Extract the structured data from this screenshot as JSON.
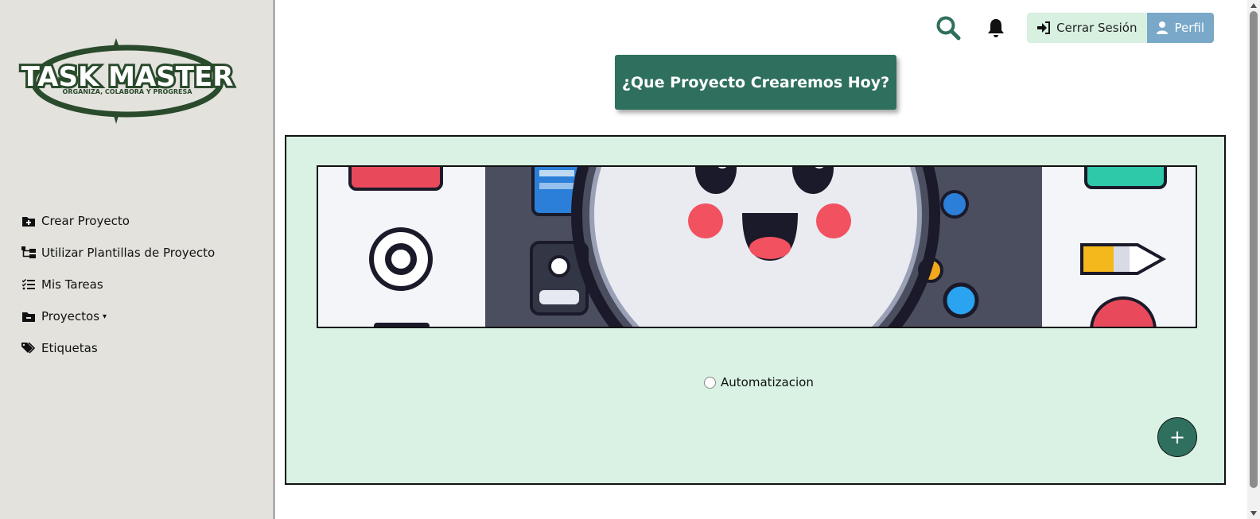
{
  "logo": {
    "title": "TASK MASTER",
    "tagline": "ORGANIZA, COLABORA Y PROGRESA"
  },
  "sidebar": {
    "items": [
      {
        "label": "Crear Proyecto",
        "icon": "folder-plus-icon"
      },
      {
        "label": "Utilizar Plantillas de Proyecto",
        "icon": "sitemap-icon"
      },
      {
        "label": "Mis Tareas",
        "icon": "list-check-icon"
      },
      {
        "label": "Proyectos",
        "icon": "folder-minus-icon",
        "dropdown": true
      },
      {
        "label": "Etiquetas",
        "icon": "tags-icon"
      }
    ]
  },
  "header": {
    "search_icon": "search-icon",
    "notification_icon": "bell-icon",
    "logout_label": "Cerrar Sesión",
    "profile_label": "Perfil"
  },
  "main": {
    "heading": "¿Que Proyecto Crearemos Hoy?",
    "option_label": "Automatizacion",
    "add_button": "+"
  },
  "colors": {
    "sidebar_bg": "#e3e2dd",
    "primary": "#2f6f5e",
    "panel_bg": "#d9f2e3",
    "logout_bg": "#d7f0e0",
    "profile_bg": "#79a8c8"
  }
}
